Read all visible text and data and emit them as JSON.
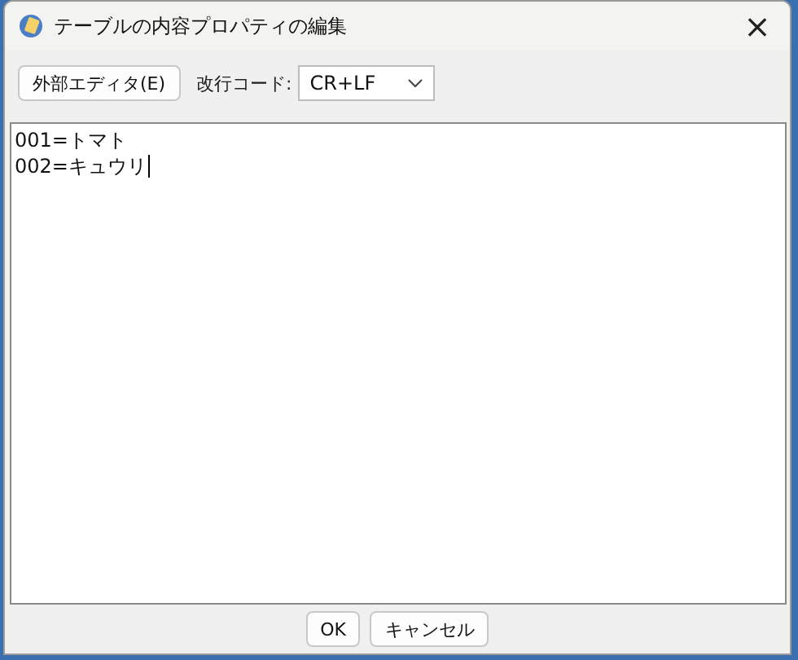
{
  "window": {
    "title": "テーブルの内容プロパティの編集",
    "close": "×"
  },
  "toolbar": {
    "external_editor_button": "外部エディタ(E)",
    "newline_label": "改行コード:",
    "newline_select": {
      "value": "CR+LF"
    }
  },
  "editor": {
    "lines": [
      "001=トマト",
      "002=キュウリ"
    ],
    "caret": true
  },
  "buttons": [
    "OK",
    "キャンセル"
  ]
}
